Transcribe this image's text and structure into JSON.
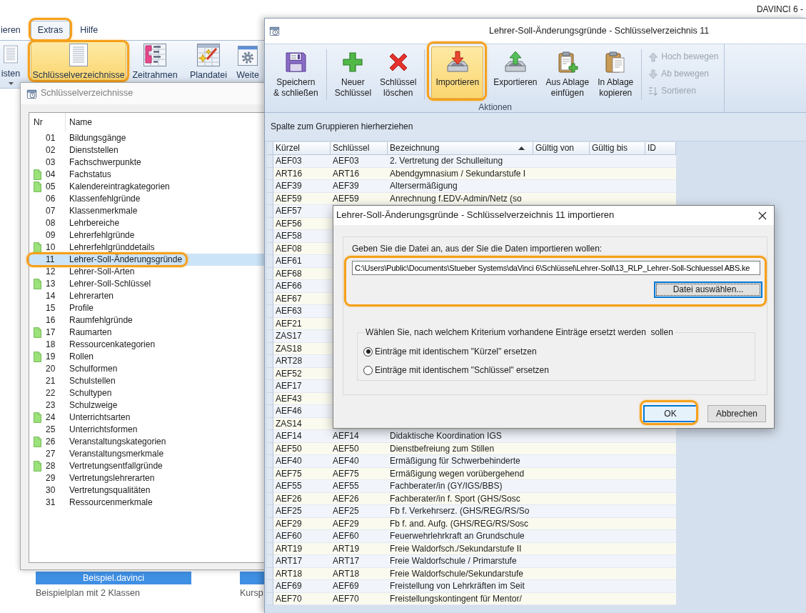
{
  "app": {
    "title": "DAVINCI 6 -",
    "menu": [
      {
        "label": "ieren",
        "selected": false,
        "highlighted": false
      },
      {
        "label": "Extras",
        "selected": true,
        "highlighted": true
      },
      {
        "label": "Hilfe",
        "selected": false,
        "highlighted": false
      }
    ],
    "ribbon": [
      {
        "label": "isten",
        "selected": false,
        "highlighted": false,
        "dropdown": true
      },
      {
        "label": "Schlüsselverzeichnisse",
        "selected": true,
        "highlighted": true,
        "dropdown": false
      },
      {
        "label": "Zeitrahmen",
        "selected": false,
        "highlighted": false,
        "dropdown": false
      },
      {
        "label": "Plandatei",
        "selected": false,
        "highlighted": false,
        "dropdown": false
      },
      {
        "label": "Weite",
        "selected": false,
        "highlighted": false,
        "dropdown": false
      }
    ],
    "plans": [
      {
        "file": "Beispiel.davinci",
        "caption": "Beispielplan mit 2 Klassen"
      },
      {
        "caption": "Kursp"
      }
    ]
  },
  "key_lists_window": {
    "title": "Schlüsselverzeichnisse",
    "columns": [
      "Nr",
      "Name"
    ],
    "rows": [
      {
        "nr": "01",
        "name": "Bildungsgänge",
        "document": false,
        "selected": false,
        "highlighted": false
      },
      {
        "nr": "02",
        "name": "Dienststellen",
        "document": false,
        "selected": false,
        "highlighted": false
      },
      {
        "nr": "03",
        "name": "Fachschwerpunkte",
        "document": false,
        "selected": false,
        "highlighted": false
      },
      {
        "nr": "04",
        "name": "Fachstatus",
        "document": true,
        "selected": false,
        "highlighted": false
      },
      {
        "nr": "05",
        "name": "Kalendereintragkategorien",
        "document": true,
        "selected": false,
        "highlighted": false
      },
      {
        "nr": "06",
        "name": "Klassenfehlgründe",
        "document": false,
        "selected": false,
        "highlighted": false
      },
      {
        "nr": "07",
        "name": "Klassenmerkmale",
        "document": false,
        "selected": false,
        "highlighted": false
      },
      {
        "nr": "08",
        "name": "Lehrbereiche",
        "document": false,
        "selected": false,
        "highlighted": false
      },
      {
        "nr": "09",
        "name": "Lehrerfehlgründe",
        "document": false,
        "selected": false,
        "highlighted": false
      },
      {
        "nr": "10",
        "name": "Lehrerfehlgründdetails",
        "document": true,
        "selected": false,
        "highlighted": false
      },
      {
        "nr": "11",
        "name": "Lehrer-Soll-Änderungsgründe",
        "document": false,
        "selected": true,
        "highlighted": true
      },
      {
        "nr": "12",
        "name": "Lehrer-Soll-Arten",
        "document": false,
        "selected": false,
        "highlighted": false
      },
      {
        "nr": "13",
        "name": "Lehrer-Soll-Schlüssel",
        "document": true,
        "selected": false,
        "highlighted": false
      },
      {
        "nr": "14",
        "name": "Lehrerarten",
        "document": false,
        "selected": false,
        "highlighted": false
      },
      {
        "nr": "15",
        "name": "Profile",
        "document": false,
        "selected": false,
        "highlighted": false
      },
      {
        "nr": "16",
        "name": "Raumfehlgründe",
        "document": false,
        "selected": false,
        "highlighted": false
      },
      {
        "nr": "17",
        "name": "Raumarten",
        "document": true,
        "selected": false,
        "highlighted": false
      },
      {
        "nr": "18",
        "name": "Ressourcenkategorien",
        "document": false,
        "selected": false,
        "highlighted": false
      },
      {
        "nr": "19",
        "name": "Rollen",
        "document": true,
        "selected": false,
        "highlighted": false
      },
      {
        "nr": "20",
        "name": "Schulformen",
        "document": false,
        "selected": false,
        "highlighted": false
      },
      {
        "nr": "21",
        "name": "Schulstellen",
        "document": false,
        "selected": false,
        "highlighted": false
      },
      {
        "nr": "22",
        "name": "Schultypen",
        "document": false,
        "selected": false,
        "highlighted": false
      },
      {
        "nr": "23",
        "name": "Schulzweige",
        "document": false,
        "selected": false,
        "highlighted": false
      },
      {
        "nr": "24",
        "name": "Unterrichtsarten",
        "document": true,
        "selected": false,
        "highlighted": false
      },
      {
        "nr": "25",
        "name": "Unterrichtsformen",
        "document": false,
        "selected": false,
        "highlighted": false
      },
      {
        "nr": "26",
        "name": "Veranstaltungskategorien",
        "document": true,
        "selected": false,
        "highlighted": false
      },
      {
        "nr": "27",
        "name": "Veranstaltungsmerkmale",
        "document": false,
        "selected": false,
        "highlighted": false
      },
      {
        "nr": "28",
        "name": "Vertretungsentfallgründe",
        "document": true,
        "selected": false,
        "highlighted": false
      },
      {
        "nr": "29",
        "name": "Vertretungslehrerarten",
        "document": false,
        "selected": false,
        "highlighted": false
      },
      {
        "nr": "30",
        "name": "Vertretungsqualitäten",
        "document": false,
        "selected": false,
        "highlighted": false
      },
      {
        "nr": "31",
        "name": "Ressourcenmerkmale",
        "document": false,
        "selected": false,
        "highlighted": false
      }
    ]
  },
  "key_window": {
    "title": "Lehrer-Soll-Änderungsgründe - Schlüsselverzeichnis 11",
    "ribbon": {
      "label": "Aktionen",
      "items": [
        {
          "kind": "large",
          "lines": [
            "Speichern",
            "& schließen"
          ],
          "selected": false,
          "highlighted": false
        },
        {
          "kind": "separator"
        },
        {
          "kind": "large",
          "lines": [
            "Neuer",
            "Schlüssel"
          ],
          "selected": false,
          "highlighted": false
        },
        {
          "kind": "large",
          "lines": [
            "Schlüssel",
            "löschen"
          ],
          "selected": false,
          "highlighted": false
        },
        {
          "kind": "separator"
        },
        {
          "kind": "large",
          "lines": [
            "Importieren"
          ],
          "selected": true,
          "highlighted": true
        },
        {
          "kind": "large",
          "lines": [
            "Exportieren"
          ],
          "selected": false,
          "highlighted": false
        },
        {
          "kind": "large",
          "lines": [
            "Aus Ablage",
            "einfügen"
          ],
          "selected": false,
          "highlighted": false
        },
        {
          "kind": "large",
          "lines": [
            "In Ablage",
            "kopieren"
          ],
          "selected": false,
          "highlighted": false
        },
        {
          "kind": "separator"
        },
        {
          "kind": "small_stack",
          "items": [
            {
              "label": "Hoch bewegen",
              "disabled": true
            },
            {
              "label": "Ab bewegen",
              "disabled": true
            },
            {
              "label": "Sortieren",
              "disabled": true
            }
          ]
        }
      ]
    },
    "group_hint": "Spalte zum Gruppieren hierherziehen",
    "columns": [
      {
        "label": "Kürzel",
        "sorted": false
      },
      {
        "label": "Schlüssel",
        "sorted": false
      },
      {
        "label": "Bezeichnung",
        "sorted": true
      },
      {
        "label": "Gültig von",
        "sorted": false
      },
      {
        "label": "Gültig bis",
        "sorted": false
      },
      {
        "label": "ID",
        "sorted": false
      }
    ],
    "rows": [
      {
        "cells": [
          "AEF03",
          "AEF03",
          "2. Vertretung der Schulleitung"
        ]
      },
      {
        "cells": [
          "ART16",
          "ART16",
          "Abendgymnasium / Sekundarstufe I"
        ]
      },
      {
        "cells": [
          "AEF39",
          "AEF39",
          "Altersermäßigung"
        ]
      },
      {
        "cells": [
          "AEF59",
          "AEF59",
          "Anrechnung f.EDV-Admin/Netz (so"
        ]
      },
      {
        "cells": [
          "AEF57"
        ]
      },
      {
        "cells": [
          "AEF56"
        ]
      },
      {
        "cells": [
          "AEF58"
        ]
      },
      {
        "cells": [
          "AEF08"
        ]
      },
      {
        "cells": [
          "AEF61"
        ]
      },
      {
        "cells": [
          "AEF68"
        ]
      },
      {
        "cells": [
          "AEF66"
        ]
      },
      {
        "cells": [
          "AEF67"
        ]
      },
      {
        "cells": [
          "AEF63"
        ]
      },
      {
        "cells": [
          "AEF21"
        ]
      },
      {
        "cells": [
          "ZAS17"
        ]
      },
      {
        "cells": [
          "ZAS18"
        ]
      },
      {
        "cells": [
          "ART28"
        ]
      },
      {
        "cells": [
          "AEF52"
        ]
      },
      {
        "cells": [
          "AEF17"
        ]
      },
      {
        "cells": [
          "AEF43"
        ]
      },
      {
        "cells": [
          "AEF46"
        ]
      },
      {
        "cells": [
          "ZAS14"
        ]
      },
      {
        "cells": [
          "AEF14",
          "AEF14",
          "Didaktische Koordination IGS"
        ]
      },
      {
        "cells": [
          "AEF50",
          "AEF50",
          "Dienstbefreiung zum Stillen"
        ]
      },
      {
        "cells": [
          "AEF40",
          "AEF40",
          "Ermäßigung für Schwerbehinderte"
        ]
      },
      {
        "cells": [
          "AEF75",
          "AEF75",
          "Ermäßigung wegen vorübergehend"
        ]
      },
      {
        "cells": [
          "AEF55",
          "AEF55",
          "Fachberater/in (GY/IGS/BBS)"
        ]
      },
      {
        "cells": [
          "AEF26",
          "AEF26",
          "Fachberater/in f. Sport (GHS/Sosc"
        ]
      },
      {
        "cells": [
          "AEF25",
          "AEF25",
          "Fb f. Verkehrserz. (GHS/REG/RS/So"
        ]
      },
      {
        "cells": [
          "AEF29",
          "AEF29",
          "Fb f. and. Aufg. (GHS/REG/RS/Sosc"
        ]
      },
      {
        "cells": [
          "AEF60",
          "AEF60",
          "Feuerwehrlehrkraft an Grundschule"
        ]
      },
      {
        "cells": [
          "ART19",
          "ART19",
          "Freie Waldorfsch./Sekundarstufe II"
        ]
      },
      {
        "cells": [
          "ART17",
          "ART17",
          "Freie Waldorfschule / Primarstufe"
        ]
      },
      {
        "cells": [
          "ART18",
          "ART18",
          "Freie Waldorfschule/Sekundarstufe"
        ]
      },
      {
        "cells": [
          "AEF69",
          "AEF69",
          "Freistellung von Lehrkräften im Seit"
        ]
      },
      {
        "cells": [
          "AEF70",
          "AEF70",
          "Freistellungskontingent für Mentor/"
        ]
      }
    ]
  },
  "import_dialog": {
    "title": "Lehrer-Soll-Änderungsgründe - Schlüsselverzeichnis 11 importieren",
    "file": {
      "prompt": "Geben Sie die Datei an, aus der Sie die Daten importieren wollen:",
      "value": "C:\\Users\\Public\\Documents\\Stueber Systems\\daVinci 6\\Schlüssel\\Lehrer-Soll\\13_RLP_Lehrer-Soll-Schluessel ABS.ke",
      "highlighted": true,
      "browse": {
        "label": "Datei auswählen...",
        "focused": true
      }
    },
    "criterion": {
      "title": "Wählen Sie, nach welchem Kriterium vorhandene Einträge ersetzt werden  sollen",
      "options": [
        {
          "label": "Einträge mit identischem \"Kürzel\" ersetzen",
          "selected": true
        },
        {
          "label": "Einträge mit identischem \"Schlüssel\" ersetzen",
          "selected": false
        }
      ]
    },
    "buttons": [
      {
        "label": "OK",
        "default": true,
        "highlighted": true
      },
      {
        "label": "Abbrechen",
        "default": false,
        "highlighted": false
      }
    ]
  }
}
